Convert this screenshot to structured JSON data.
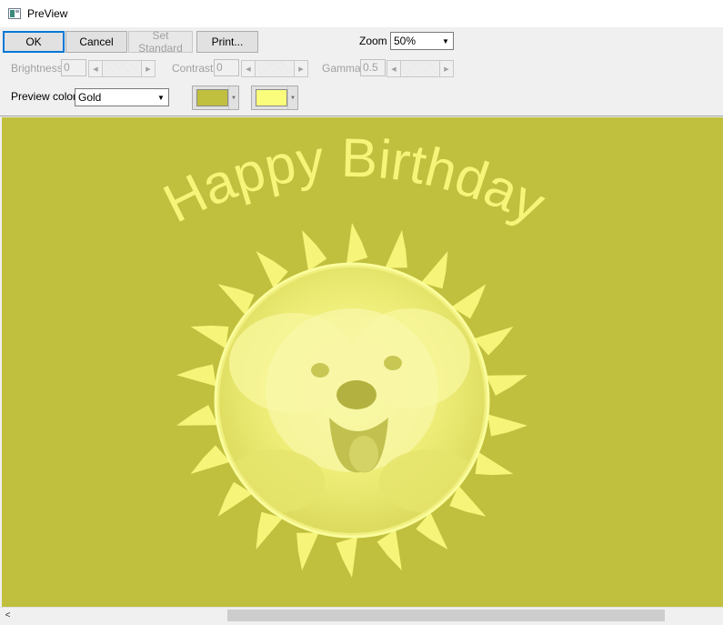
{
  "window": {
    "title": "PreView"
  },
  "toolbar": {
    "ok": "OK",
    "cancel": "Cancel",
    "set_standard": "Set Standard",
    "print": "Print...",
    "zoom_label": "Zoom",
    "zoom_value": "50%",
    "brightness_label": "Brightness",
    "brightness_value": "0",
    "contrast_label": "Contrast",
    "contrast_value": "0",
    "gamma_label": "Gamma",
    "gamma_value": "0.5",
    "preview_color_label": "Preview color",
    "preview_color_value": "Gold",
    "dark_color": "#c0bf3e",
    "light_color": "#fafd7c"
  },
  "preview": {
    "headline": "Happy Birthday",
    "background_color": "#c0bf3e",
    "ink_color": "#f6f57a"
  },
  "scrollbar": {
    "thumb_fraction": 0.6
  }
}
